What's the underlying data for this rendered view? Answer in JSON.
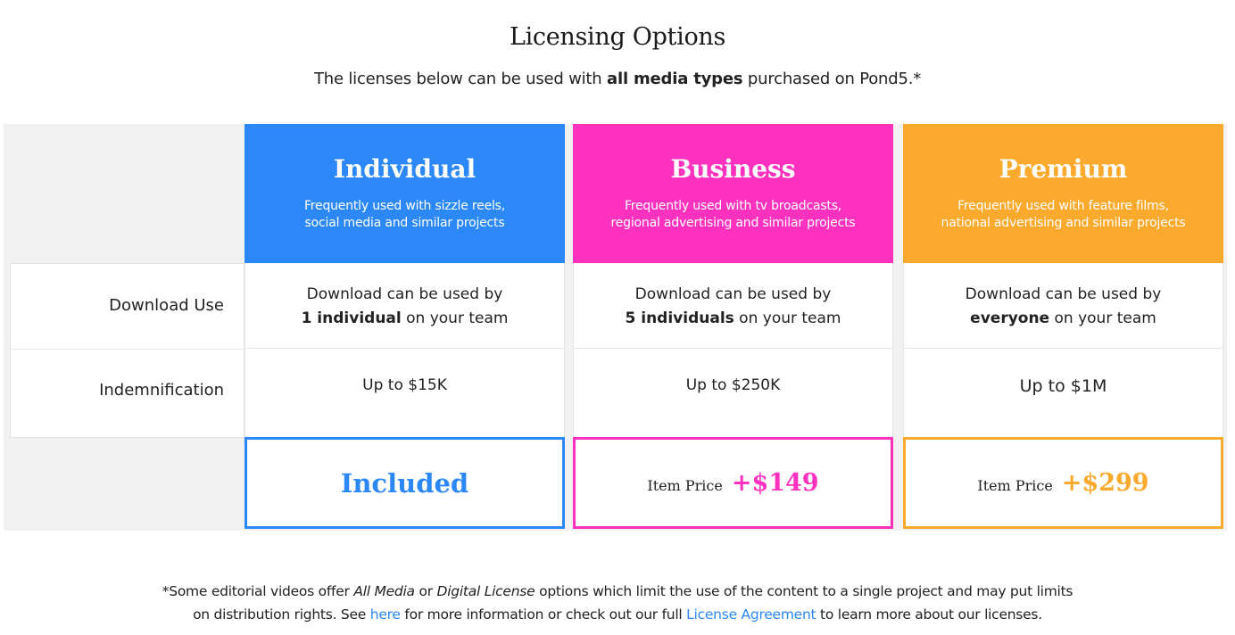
{
  "header": {
    "title": "Licensing Options",
    "subtitle_prefix": "The licenses below can be used with ",
    "subtitle_bold": "all media types",
    "subtitle_suffix": " purchased on Pond5.*"
  },
  "row_labels": [
    "Download Use",
    "Indemnification"
  ],
  "plans": [
    {
      "name": "Individual",
      "color": "#2b88f6",
      "description_line1": "Frequently used with sizzle reels,",
      "description_line2": "social media and similar projects",
      "download_use_line1": "Download can be used by",
      "download_use_bold": "1 individual",
      "download_use_suffix": " on your team",
      "indemnification": "Up to $15K",
      "price_text": "Included"
    },
    {
      "name": "Business",
      "color": "#ff32c0",
      "description_line1": "Frequently used with tv broadcasts,",
      "description_line2": "regional advertising and similar projects",
      "download_use_line1": "Download can be used by",
      "download_use_bold": "5 individuals",
      "download_use_suffix": " on your team",
      "indemnification": "Up to $250K",
      "price_label": "Item Price",
      "price_amount": "+$149"
    },
    {
      "name": "Premium",
      "color": "#fcaa2d",
      "description_line1": "Frequently used with feature films,",
      "description_line2": "national advertising and similar projects",
      "download_use_line1": "Download can be used by",
      "download_use_bold": "everyone",
      "download_use_suffix": " on your team",
      "indemnification": "Up to $1M",
      "price_label": "Item Price",
      "price_amount": "+$299"
    }
  ],
  "footnote": {
    "part1": "*Some editorial videos offer ",
    "italic1": "All Media",
    "part2": " or ",
    "italic2": "Digital License",
    "part3": " options which limit the use of the content to a single project and may put limits",
    "part4": "on distribution rights. See ",
    "link1": "here",
    "part5": " for more information or check out our full ",
    "link2": "License Agreement",
    "part6": " to learn more about our licenses.",
    "link_color": "#2b87f5"
  }
}
